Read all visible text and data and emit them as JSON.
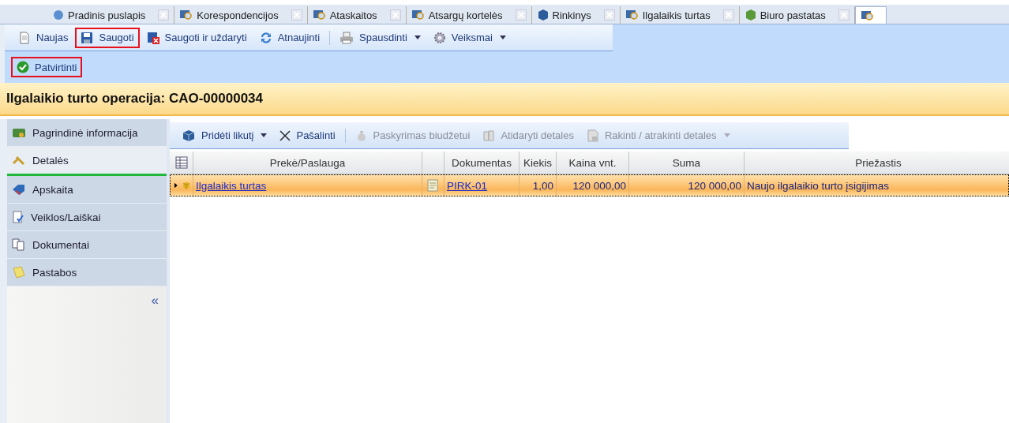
{
  "tabs": [
    {
      "label": "Pradinis puslapis",
      "selected": false
    },
    {
      "label": "Korespondencijos",
      "selected": false
    },
    {
      "label": "Ataskaitos",
      "selected": false
    },
    {
      "label": "Atsargų kortelės",
      "selected": false
    },
    {
      "label": "Rinkinys",
      "selected": false
    },
    {
      "label": "Ilgalaikis turtas",
      "selected": false
    },
    {
      "label": "Biuro pastatas",
      "selected": false
    },
    {
      "selected": true
    }
  ],
  "toolbar": [
    {
      "kind": "button",
      "label": "Naujas",
      "highlighted": false
    },
    {
      "kind": "button",
      "label": "Saugoti",
      "highlighted": true
    },
    {
      "kind": "button",
      "label": "Saugoti ir uždaryti",
      "highlighted": false
    },
    {
      "kind": "button",
      "label": "Atnaujinti",
      "highlighted": false
    },
    {
      "kind": "separator"
    },
    {
      "kind": "dropdown",
      "label": "Spausdinti",
      "highlighted": false
    },
    {
      "kind": "dropdown",
      "label": "Veiksmai",
      "highlighted": false
    }
  ],
  "toolbar_2": [
    {
      "kind": "button",
      "label": "Patvirtinti",
      "highlighted": true
    }
  ],
  "header": {
    "title": "Ilgalaikio turto operacija: CAO-00000034"
  },
  "nav": {
    "items": [
      {
        "label": "Pagrindinė informacija",
        "selected": false
      },
      {
        "label": "Detalės",
        "selected": true
      },
      {
        "label": "Apskaita",
        "selected": false
      },
      {
        "label": "Veiklos/Laiškai",
        "selected": false
      },
      {
        "label": "Dokumentai",
        "selected": false
      },
      {
        "label": "Pastabos",
        "selected": false
      }
    ],
    "collapse": "«"
  },
  "grid_toolbar": [
    {
      "kind": "dropdown",
      "label": "Pridėti likutį",
      "disabled": false
    },
    {
      "kind": "button",
      "label": "Pašalinti",
      "disabled": false
    },
    {
      "kind": "separator"
    },
    {
      "kind": "button",
      "label": "Paskyrimas biudžetui",
      "disabled": true
    },
    {
      "kind": "button",
      "label": "Atidaryti detales",
      "disabled": true
    },
    {
      "kind": "dropdown",
      "label": "Rakinti / atrakinti detales",
      "disabled": true
    }
  ],
  "table": {
    "columns": [
      {
        "kind": "icon"
      },
      {
        "kind": "text",
        "label": "Prekė/Paslauga"
      },
      {
        "kind": "icon"
      },
      {
        "kind": "text",
        "label": "Dokumentas"
      },
      {
        "kind": "text",
        "label": "Kiekis"
      },
      {
        "kind": "text",
        "label": "Kaina vnt."
      },
      {
        "kind": "text",
        "label": "Suma"
      },
      {
        "kind": "text",
        "label": "Priežastis"
      }
    ],
    "rows": [
      {
        "selected": true,
        "cells": [
          {
            "kind": "icon"
          },
          {
            "kind": "link",
            "text": "Ilgalaikis turtas"
          },
          {
            "kind": "icon"
          },
          {
            "kind": "link",
            "text": "PIRK-01"
          },
          {
            "kind": "number",
            "text": "1,00"
          },
          {
            "kind": "number",
            "text": "120 000,00"
          },
          {
            "kind": "number",
            "text": "120 000,00"
          },
          {
            "kind": "text",
            "text": "Naujo ilgalaikio turto įsigijimas"
          }
        ]
      }
    ]
  }
}
